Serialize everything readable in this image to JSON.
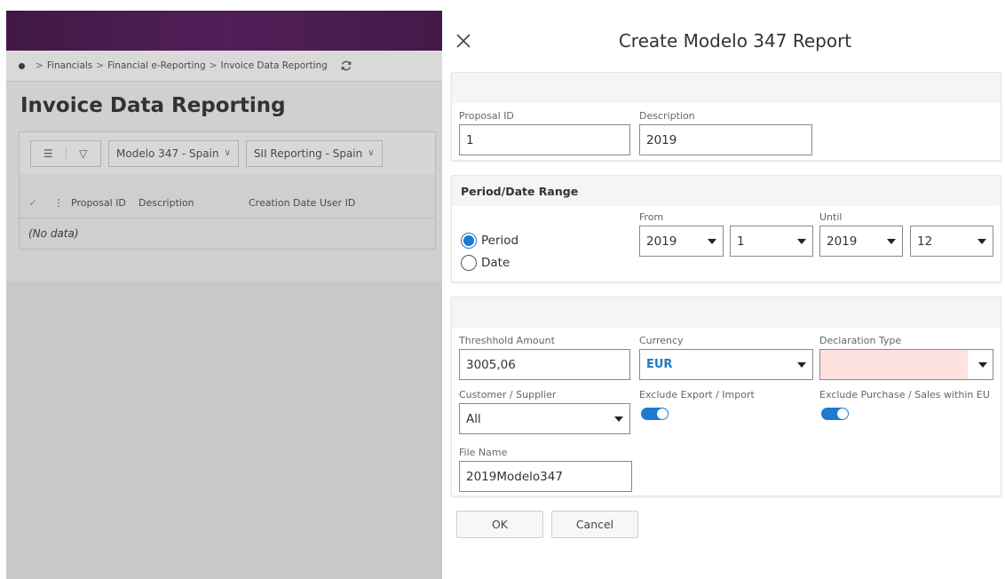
{
  "background_page": {
    "breadcrumb": [
      "Financials",
      "Financial e-Reporting",
      "Invoice Data Reporting"
    ],
    "breadcrumb_separator": ">",
    "title": "Invoice Data Reporting",
    "toolbar": {
      "list_icon": "list-icon",
      "filter_icon": "filter-icon",
      "dropdown1_label": "Modelo 347 - Spain",
      "dropdown2_label": "SII Reporting - Spain"
    },
    "table": {
      "columns": [
        "Proposal ID",
        "Description",
        "Creation Date",
        "User ID"
      ],
      "empty_text": "(No data)"
    },
    "header_color": "#5d2365"
  },
  "dialog": {
    "title": "Create Modelo 347 Report",
    "close_icon": "close-icon",
    "section1": {
      "proposal_id_label": "Proposal ID",
      "proposal_id_value": "1",
      "description_label": "Description",
      "description_value": "2019"
    },
    "section2": {
      "heading": "Period/Date Range",
      "from_label": "From",
      "until_label": "Until",
      "radio_period": "Period",
      "radio_date": "Date",
      "selected_radio": "Period",
      "from_year": "2019",
      "from_period": "1",
      "until_year": "2019",
      "until_period": "12"
    },
    "section3": {
      "threshold_label": "Threshhold Amount",
      "threshold_value": "3005,06",
      "currency_label": "Currency",
      "currency_value": "EUR",
      "declaration_label": "Declaration Type",
      "declaration_value": "",
      "customer_supplier_label": "Customer / Supplier",
      "customer_supplier_value": "All",
      "exclude_export_label": "Exclude Export / Import",
      "exclude_export_on": true,
      "exclude_eu_label": "Exclude Purchase / Sales within EU",
      "exclude_eu_on": true,
      "file_name_label": "File Name",
      "file_name_value": "2019Modelo347"
    },
    "ok_label": "OK",
    "cancel_label": "Cancel",
    "accent_color": "#1c7bd0",
    "invalid_color": "#fde2e0"
  }
}
